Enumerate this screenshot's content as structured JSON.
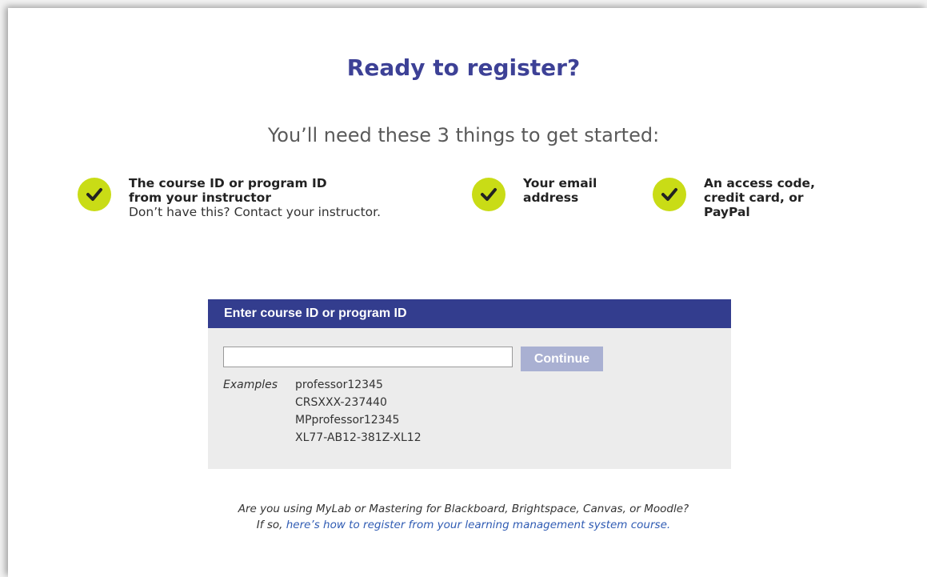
{
  "title": "Ready to register?",
  "subtitle": "You’ll need these 3 things to get started:",
  "requirements": [
    {
      "bold": "The course ID or program ID\nfrom your instructor",
      "note": "Don’t have this? Contact your instructor.",
      "icon": "check-icon"
    },
    {
      "bold": "Your email\naddress",
      "note": "",
      "icon": "check-icon"
    },
    {
      "bold": "An access code,\ncredit card, or\nPayPal",
      "note": "",
      "icon": "check-icon"
    }
  ],
  "panel": {
    "header": "Enter course ID or program ID",
    "input_value": "",
    "input_placeholder": "",
    "continue_label": "Continue",
    "examples_label": "Examples",
    "examples": [
      "professor12345",
      "CRSXXX-237440",
      "MPprofessor12345",
      "XL77-AB12-381Z-XL12"
    ]
  },
  "footer": {
    "line1": "Are you using MyLab or Mastering for Blackboard, Brightspace, Canvas, or Moodle?",
    "line2_prefix": "If so, ",
    "link_text": "here’s how to register from your learning management system course."
  },
  "colors": {
    "title": "#3d4196",
    "accent_check": "#c9dc16",
    "panel_header": "#333d8e",
    "continue_disabled": "#a9b0d2",
    "link": "#2f5bb3"
  }
}
